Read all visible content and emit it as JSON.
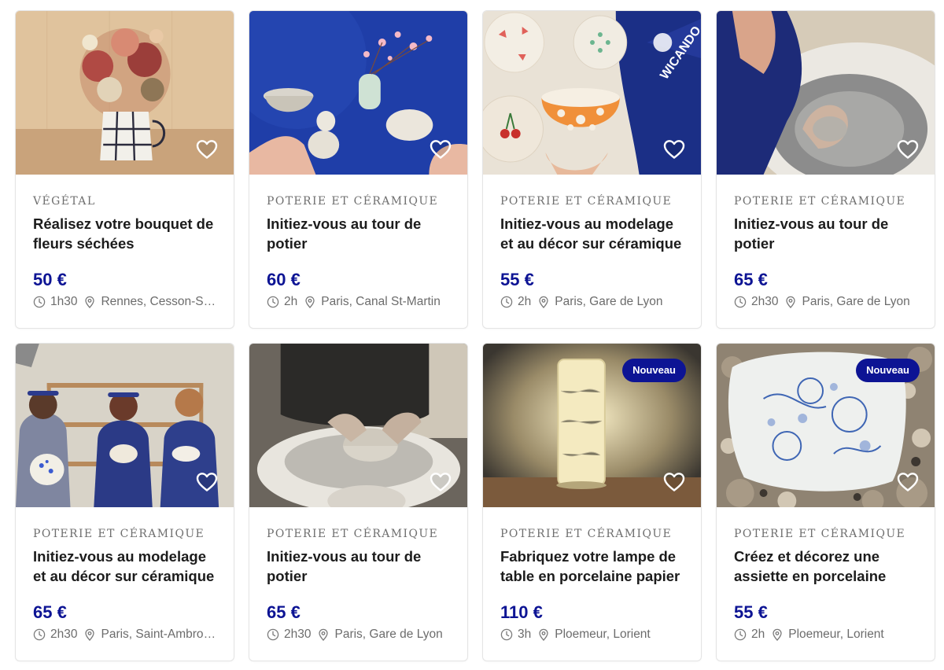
{
  "listing": {
    "cards": [
      {
        "category": "Végétal",
        "title": "Réalisez votre bouquet de fleurs séchées",
        "price": "50 €",
        "duration": "1h30",
        "location": "Rennes, Cesson-Sé…",
        "badge": "",
        "image": "dried-flower-bouquet"
      },
      {
        "category": "Poterie et céramique",
        "title": "Initiez-vous au tour de potier",
        "price": "60 €",
        "duration": "2h",
        "location": "Paris, Canal St-Martin",
        "badge": "",
        "image": "hands-holding-ceramics"
      },
      {
        "category": "Poterie et céramique",
        "title": "Initiez-vous au modelage et au décor sur céramique",
        "price": "55 €",
        "duration": "2h",
        "location": "Paris, Gare de Lyon",
        "badge": "",
        "image": "painted-ceramic-bowls"
      },
      {
        "category": "Poterie et céramique",
        "title": "Initiez-vous au tour de potier",
        "price": "65 €",
        "duration": "2h30",
        "location": "Paris, Gare de Lyon",
        "badge": "",
        "image": "potters-wheel"
      },
      {
        "category": "Poterie et céramique",
        "title": "Initiez-vous au modelage et au décor sur céramique",
        "price": "65 €",
        "duration": "2h30",
        "location": "Paris, Saint-Ambroi…",
        "badge": "",
        "image": "three-women-workshop"
      },
      {
        "category": "Poterie et céramique",
        "title": "Initiez-vous au tour de potier",
        "price": "65 €",
        "duration": "2h30",
        "location": "Paris, Gare de Lyon",
        "badge": "",
        "image": "throwing-pot-on-wheel"
      },
      {
        "category": "Poterie et céramique",
        "title": "Fabriquez votre lampe de table en porcelaine papier",
        "price": "110 €",
        "duration": "3h",
        "location": "Ploemeur, Lorient",
        "badge": "Nouveau",
        "image": "porcelain-lamp"
      },
      {
        "category": "Poterie et céramique",
        "title": "Créez et décorez une assiette en porcelaine",
        "price": "55 €",
        "duration": "2h",
        "location": "Ploemeur, Lorient",
        "badge": "Nouveau",
        "image": "porcelain-plate-shells"
      }
    ]
  },
  "icons": {
    "favorite": "heart-outline-icon",
    "duration": "clock-icon",
    "location": "map-pin-icon"
  },
  "colors": {
    "accent": "#0d1494",
    "category_text": "#6f6f6f",
    "meta_text": "#6c6c6c"
  }
}
